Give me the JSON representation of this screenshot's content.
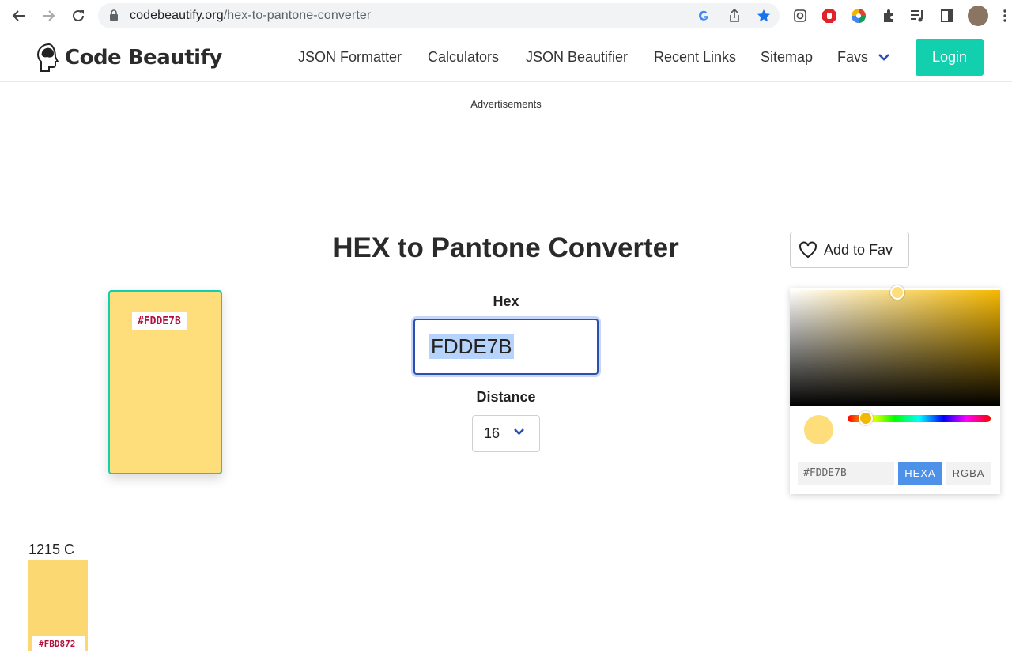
{
  "browser": {
    "url_host": "codebeautify.org",
    "url_path": "/hex-to-pantone-converter"
  },
  "header": {
    "logo_text": "Code Beautify",
    "nav": [
      "JSON Formatter",
      "Calculators",
      "JSON Beautifier",
      "Recent Links",
      "Sitemap",
      "Favs"
    ],
    "login_label": "Login"
  },
  "ads_label": "Advertisements",
  "page_title": "HEX to Pantone Converter",
  "fav_label": "Add to Fav",
  "preview": {
    "hex_tag": "#FDDE7B",
    "color": "#FDDE7B"
  },
  "form": {
    "hex_label": "Hex",
    "hex_value": "FDDE7B",
    "distance_label": "Distance",
    "distance_value": "16"
  },
  "picker": {
    "hex_field": "#FDDE7B",
    "mode_hexa": "HEXA",
    "mode_rgba": "RGBA"
  },
  "result": {
    "pantone_name": "1215 C",
    "hex_tag": "#FBD872",
    "color": "#FBD872"
  },
  "colors": {
    "accent": "#12cfae",
    "input_focus": "#2b4fb0",
    "tag_text": "#b5103c",
    "mode_active": "#4e91e8"
  }
}
